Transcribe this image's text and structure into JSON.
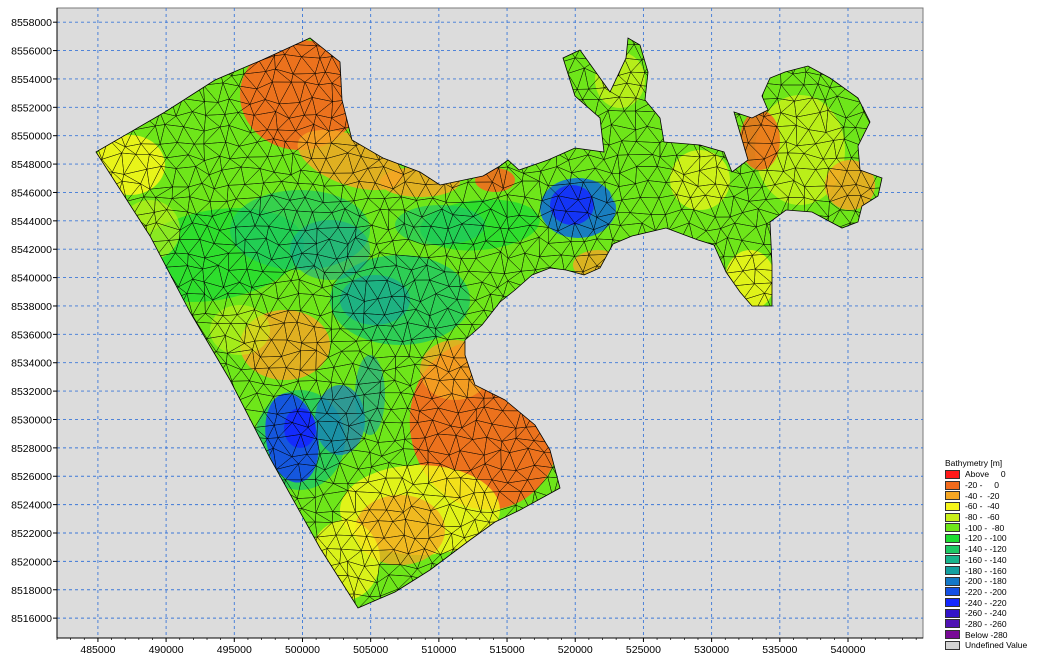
{
  "map": {
    "x_ticks": [
      "485000",
      "490000",
      "495000",
      "500000",
      "505000",
      "510000",
      "515000",
      "520000",
      "525000",
      "530000",
      "535000",
      "540000"
    ],
    "y_ticks": [
      "8558000",
      "8556000",
      "8554000",
      "8552000",
      "8550000",
      "8548000",
      "8546000",
      "8544000",
      "8542000",
      "8540000",
      "8538000",
      "8536000",
      "8534000",
      "8532000",
      "8530000",
      "8528000",
      "8526000",
      "8524000",
      "8522000",
      "8520000",
      "8518000",
      "8516000"
    ],
    "x_range": [
      482000,
      545500
    ],
    "y_range": [
      8514600,
      8559000
    ],
    "background_color": "#dcdcdc",
    "grid_color": "#3c78d8",
    "mesh_color": "#000000"
  },
  "legend": {
    "title": "Bathymetry [m]",
    "items": [
      {
        "label": "Above     0",
        "color": "#ff1a1a"
      },
      {
        "label": "-20 -     0",
        "color": "#f26b1d"
      },
      {
        "label": "-40 -  -20",
        "color": "#f5a623"
      },
      {
        "label": "-60 -  -40",
        "color": "#f5f51a"
      },
      {
        "label": "-80 -  -60",
        "color": "#c8f01a"
      },
      {
        "label": "-100 -  -80",
        "color": "#6ee61a"
      },
      {
        "label": "-120 - -100",
        "color": "#1edc32"
      },
      {
        "label": "-140 - -120",
        "color": "#1ec864"
      },
      {
        "label": "-160 - -140",
        "color": "#18b48c"
      },
      {
        "label": "-180 - -160",
        "color": "#14a0a0"
      },
      {
        "label": "-200 - -180",
        "color": "#1478c8"
      },
      {
        "label": "-220 - -200",
        "color": "#1450e6"
      },
      {
        "label": "-240 - -220",
        "color": "#1428ff"
      },
      {
        "label": "-260 - -240",
        "color": "#3214c8"
      },
      {
        "label": "-280 - -260",
        "color": "#5014b4"
      },
      {
        "label": "Below -280",
        "color": "#780a96"
      },
      {
        "label": "Undefined Value",
        "color": "#d3d3d3"
      }
    ]
  }
}
